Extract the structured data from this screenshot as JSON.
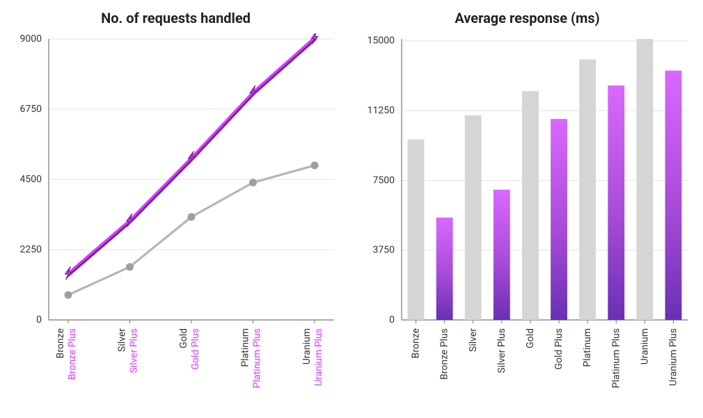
{
  "chart_data": [
    {
      "type": "line",
      "title": "No. of requests handled",
      "categories": [
        "Bronze",
        "Silver",
        "Gold",
        "Platinum",
        "Uranium"
      ],
      "categories_plus": [
        "Bronze Plus",
        "Silver Plus",
        "Gold Plus",
        "Platinum Plus",
        "Uranium Plus"
      ],
      "yticks": [
        0,
        2250,
        4500,
        6750,
        9000
      ],
      "ylim": [
        0,
        9000
      ],
      "series": [
        {
          "name": "base",
          "color_line": "#b5b5b5",
          "color_marker": "#9e9e9e",
          "values": [
            800,
            1700,
            3300,
            4400,
            4950
          ]
        },
        {
          "name": "plus",
          "color_line": "#d83dff",
          "color_shadow": "#7c1fa2",
          "values": [
            1500,
            3200,
            5200,
            7300,
            9050
          ]
        }
      ],
      "colors": {
        "axis": "#777",
        "grid": "#e3e3e3",
        "tick_text": "#333",
        "x_label_base": "#333",
        "x_label_plus": "#d83dff"
      }
    },
    {
      "type": "bar",
      "title": "Average response (ms)",
      "categories": [
        "Bronze",
        "Bronze Plus",
        "Silver",
        "Silver Plus",
        "Gold",
        "Gold Plus",
        "Platinum",
        "Platinum Plus",
        "Uranium",
        "Uranium Plus"
      ],
      "yticks": [
        0,
        3750,
        7500,
        11250,
        15000
      ],
      "ylim": [
        0,
        15100
      ],
      "values": [
        9700,
        5500,
        11000,
        7000,
        12300,
        10800,
        14000,
        12600,
        15100,
        13400
      ],
      "styles": [
        "gray",
        "grad",
        "gray",
        "grad",
        "gray",
        "grad",
        "gray",
        "grad",
        "gray",
        "grad"
      ],
      "colors": {
        "axis": "#777",
        "grid": "#e3e3e3",
        "tick_text": "#333",
        "x_label": "#333",
        "bar_gray": "#d5d5d5",
        "bar_grad_top": "#d968ff",
        "bar_grad_bottom": "#6a2fb5"
      },
      "grad_stops": [
        {
          "offset": "0%",
          "color": "#d968ff"
        },
        {
          "offset": "55%",
          "color": "#a84bd8"
        },
        {
          "offset": "100%",
          "color": "#6a2fb5"
        }
      ]
    }
  ]
}
